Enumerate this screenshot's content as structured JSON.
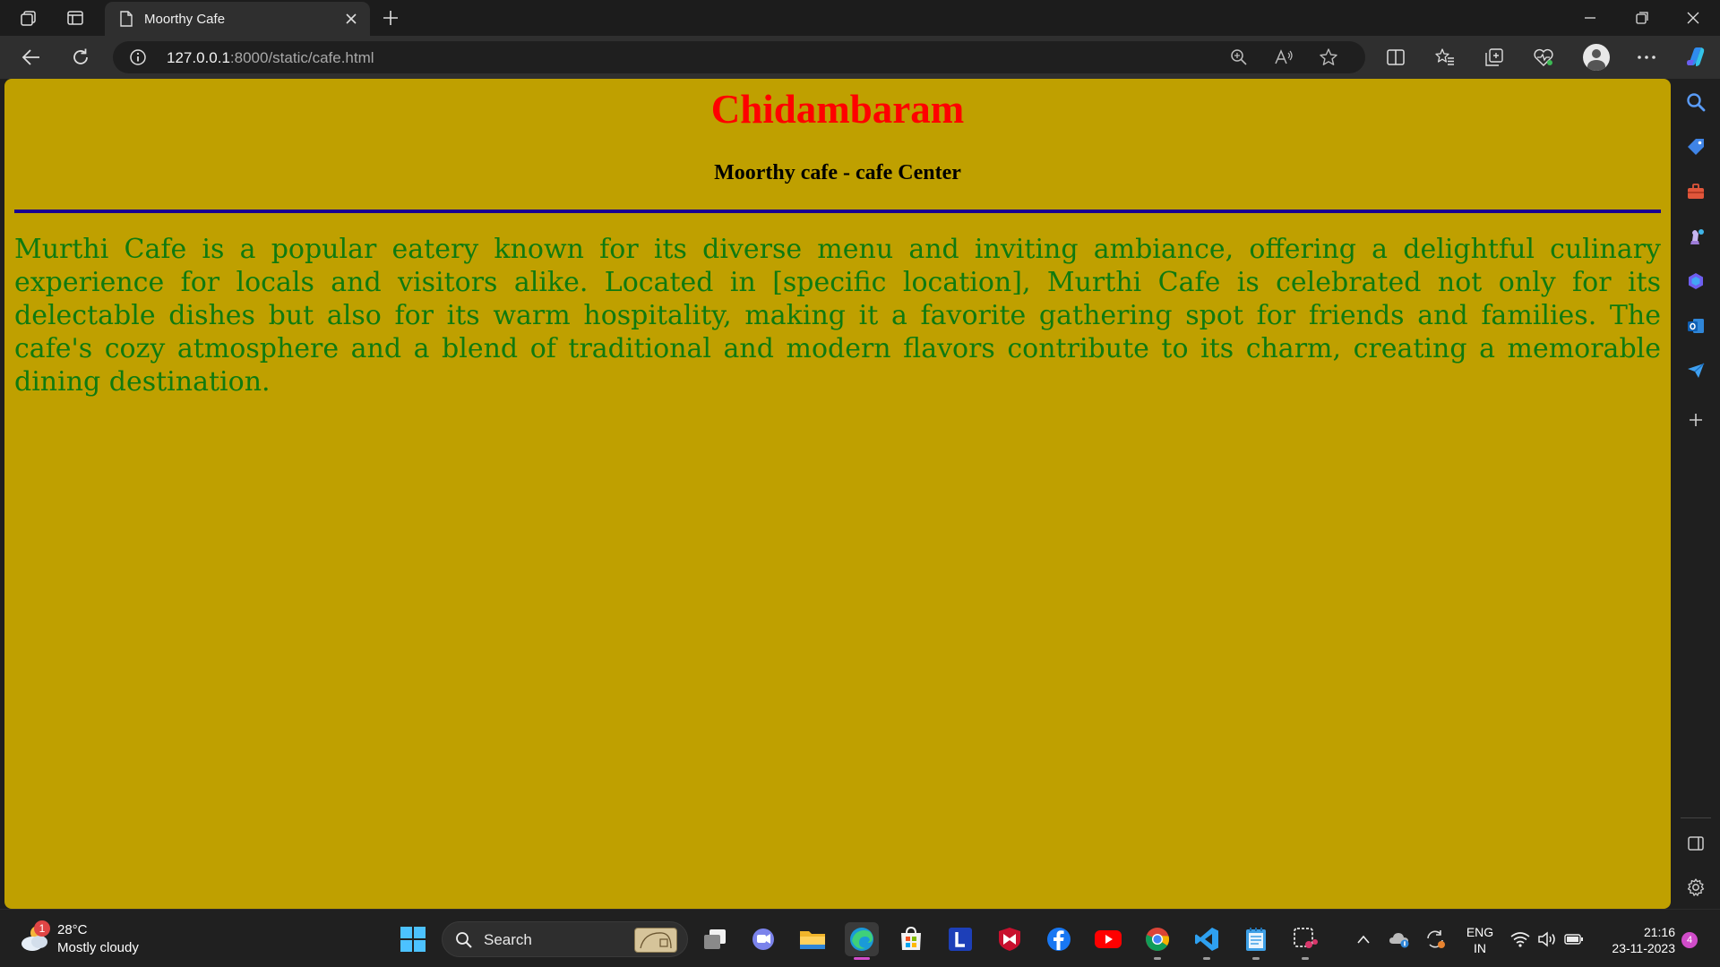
{
  "browser": {
    "tab_title": "Moorthy Cafe",
    "url_host": "127.0.0.1",
    "url_rest": ":8000/static/cafe.html"
  },
  "page": {
    "heading": "Chidambaram",
    "subheading": "Moorthy cafe - cafe Center",
    "paragraph": "Murthi Cafe is a popular eatery known for its diverse menu and inviting ambiance, offering a delightful culinary experience for locals and visitors alike. Located in [specific location], Murthi Cafe is celebrated not only for its delectable dishes but also for its warm hospitality, making it a favorite gathering spot for friends and families. The cafe's cozy atmosphere and a blend of traditional and modern flavors contribute to its charm, creating a memorable dining destination.",
    "background_color": "#bfa000",
    "heading_color": "#ff0000",
    "text_color": "#0f7a0f",
    "rule_color": "#1a0090"
  },
  "taskbar": {
    "weather_badge": "1",
    "weather_temp": "28°C",
    "weather_desc": "Mostly cloudy",
    "search_label": "Search",
    "lang_line1": "ENG",
    "lang_line2": "IN",
    "time": "21:16",
    "date": "23-11-2023",
    "notification_count": "4"
  }
}
